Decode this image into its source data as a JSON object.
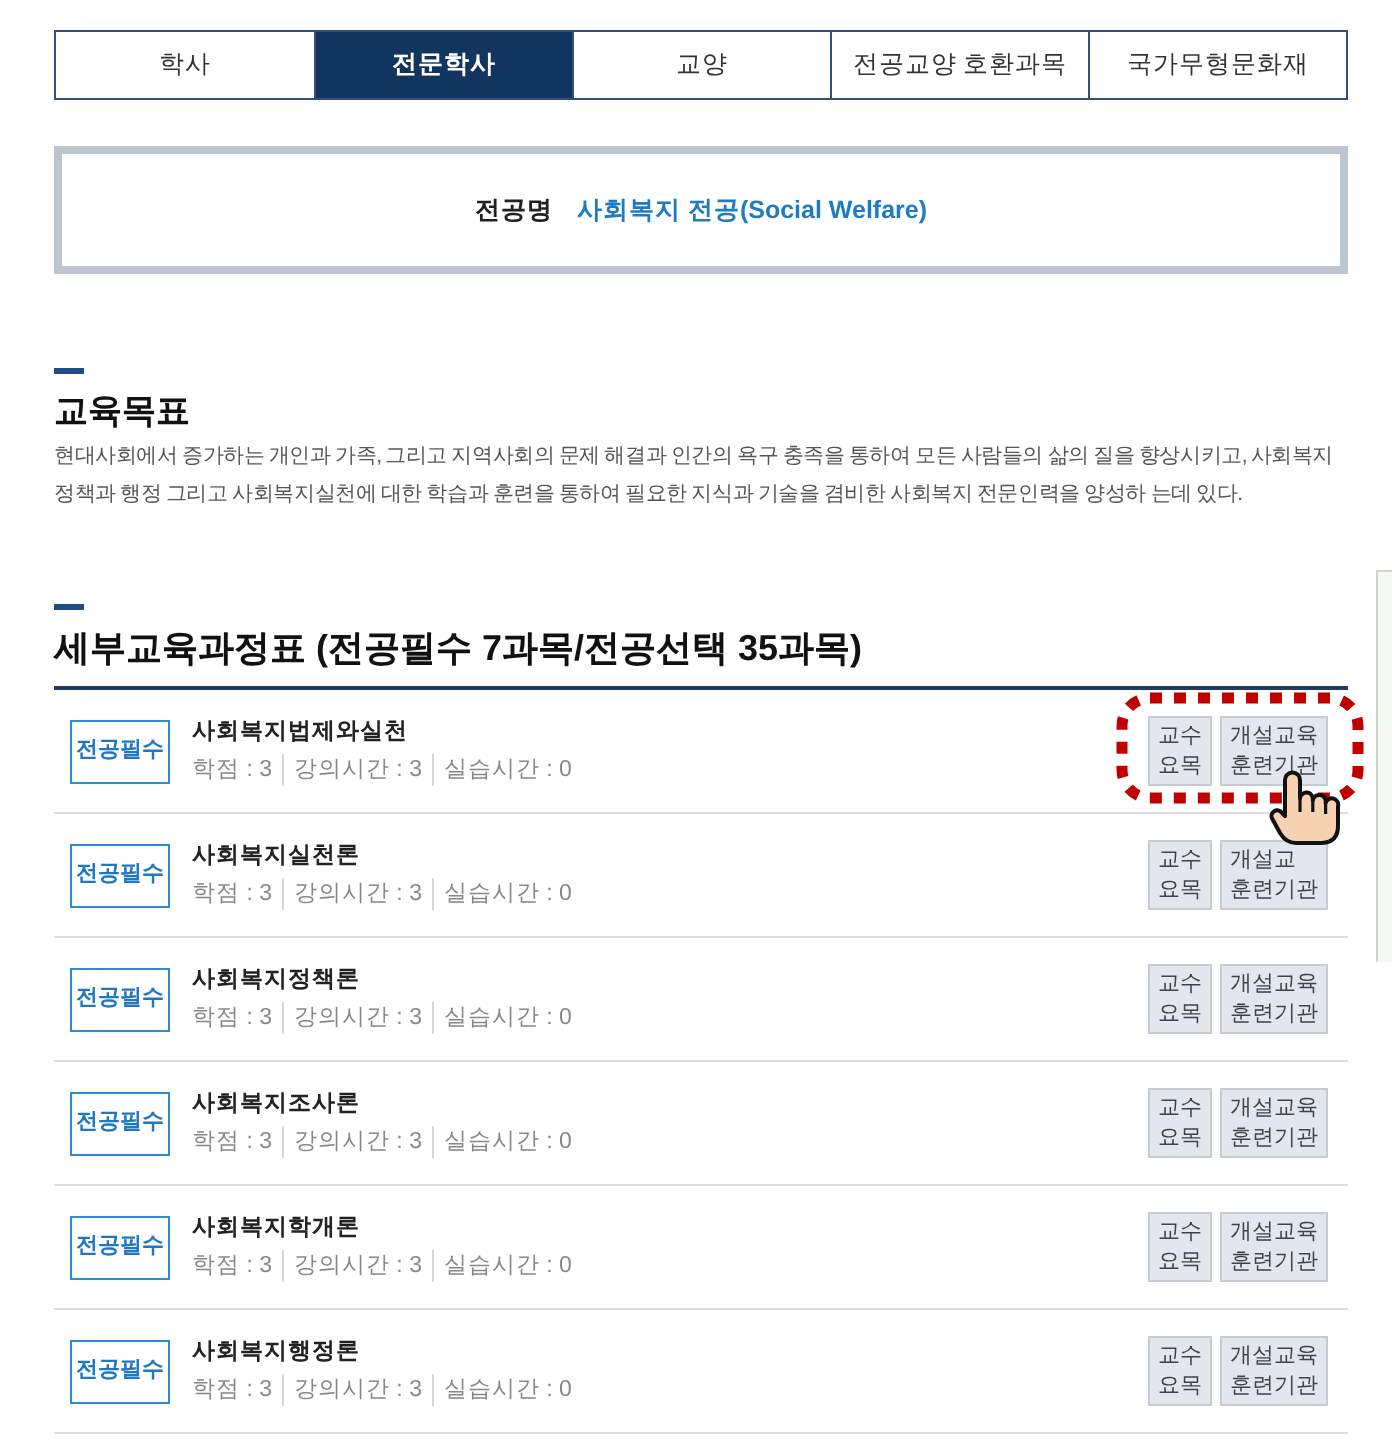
{
  "tabs": [
    {
      "label": "학사",
      "selected": false
    },
    {
      "label": "전문학사",
      "selected": true
    },
    {
      "label": "교양",
      "selected": false
    },
    {
      "label": "전공교양 호환과목",
      "selected": false
    },
    {
      "label": "국가무형문화재",
      "selected": false
    }
  ],
  "major": {
    "label": "전공명",
    "value": "사회복지 전공(Social Welfare)"
  },
  "objective": {
    "heading": "교육목표",
    "text": "현대사회에서 증가하는 개인과 가족, 그리고 지역사회의 문제 해결과 인간의 욕구 충족을 통하여 모든 사람들의 삶의 질을 향상시키고, 사회복지 정책과 행정 그리고 사회복지실천에 대한 학습과 훈련을 통하여 필요한 지식과 기술을 겸비한 사회복지 전문인력을 양성하 는데 있다."
  },
  "curriculum": {
    "heading": "세부교육과정표 (전공필수 7과목/전공선택 35과목)",
    "courses": [
      {
        "badge": "전공필수",
        "name": "사회복지법제와실천",
        "details": [
          "학점 : 3",
          "강의시간 : 3",
          "실습시간 : 0"
        ],
        "buttons": [
          "교수\n요목",
          "개설교육\n훈련기관"
        ],
        "circled": true,
        "cursor": true
      },
      {
        "badge": "전공필수",
        "name": "사회복지실천론",
        "details": [
          "학점 : 3",
          "강의시간 : 3",
          "실습시간 : 0"
        ],
        "buttons": [
          "교수\n요목",
          "개설교\n훈련기관"
        ],
        "circled": false,
        "cursor": false
      },
      {
        "badge": "전공필수",
        "name": "사회복지정책론",
        "details": [
          "학점 : 3",
          "강의시간 : 3",
          "실습시간 : 0"
        ],
        "buttons": [
          "교수\n요목",
          "개설교육\n훈련기관"
        ],
        "circled": false,
        "cursor": false
      },
      {
        "badge": "전공필수",
        "name": "사회복지조사론",
        "details": [
          "학점 : 3",
          "강의시간 : 3",
          "실습시간 : 0"
        ],
        "buttons": [
          "교수\n요목",
          "개설교육\n훈련기관"
        ],
        "circled": false,
        "cursor": false
      },
      {
        "badge": "전공필수",
        "name": "사회복지학개론",
        "details": [
          "학점 : 3",
          "강의시간 : 3",
          "실습시간 : 0"
        ],
        "buttons": [
          "교수\n요목",
          "개설교육\n훈련기관"
        ],
        "circled": false,
        "cursor": false
      },
      {
        "badge": "전공필수",
        "name": "사회복지행정론",
        "details": [
          "학점 : 3",
          "강의시간 : 3",
          "실습시간 : 0"
        ],
        "buttons": [
          "교수\n요목",
          "개설교육\n훈련기관"
        ],
        "circled": false,
        "cursor": false
      }
    ]
  }
}
